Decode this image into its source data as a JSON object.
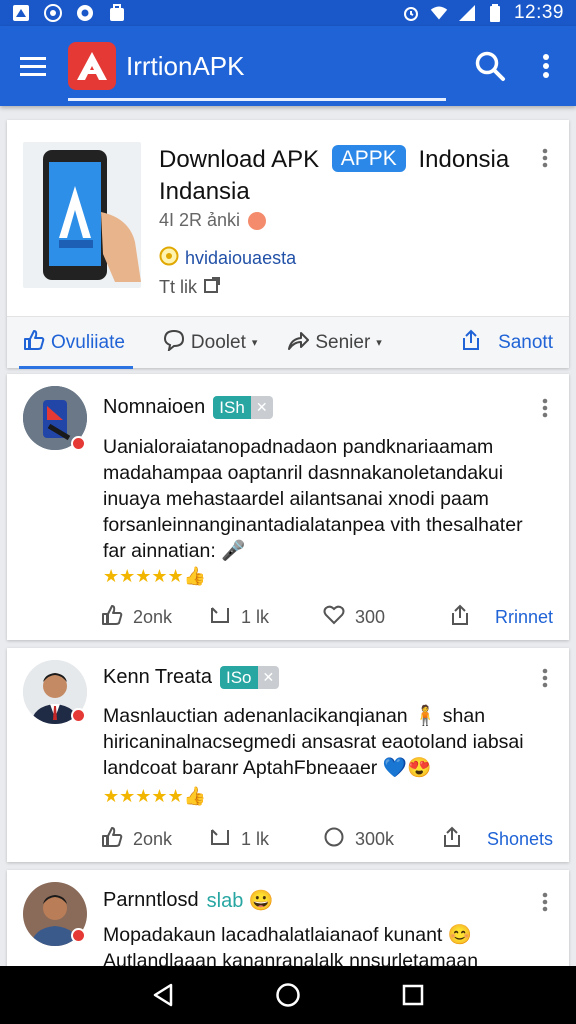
{
  "status_bar": {
    "time": "12:39",
    "icons": [
      "notification-icon",
      "whatsapp-icon",
      "circle-app-icon",
      "bag-icon",
      "alarm-icon",
      "wifi-icon",
      "signal-icon",
      "battery-icon"
    ]
  },
  "app_bar": {
    "title": "IrrtionAPK",
    "icons": [
      "menu-icon",
      "app-logo-icon",
      "search-icon",
      "more-vert-icon"
    ]
  },
  "app_card": {
    "title_before": "Download APK",
    "badge": "APPK",
    "title_after": "Indonsia Indansia",
    "meta": "4I 2R ảnki",
    "developer": "hvidaiouaesta",
    "link": "Tt lik",
    "actions": [
      {
        "label": "Ovuliiate",
        "icon": "thumbs-up-icon"
      },
      {
        "label": "Doolet",
        "icon": "comment-icon"
      },
      {
        "label": "Senier",
        "icon": "share-arrow-icon"
      },
      {
        "label": "Sanott",
        "icon": "share-box-icon"
      }
    ]
  },
  "posts": [
    {
      "name": "Nomnaioen",
      "tag": "ISh",
      "text_lines": [
        "Uanialoraiatanopadnadaon pandknariaamam",
        "madahampaa oaptanril dasnnakanoletandakui",
        "inuaya mehastaardel ailantsanai xnodi paam",
        "forsanleinnanginantadialatanpea vith thesalhater",
        "far ainnatian: 🎤"
      ],
      "stars": "★★★★★👍",
      "likes": "2onk",
      "replies": "1 lk",
      "comments": "300",
      "share": "Rrinnet"
    },
    {
      "name": "Kenn Treata",
      "tag": "ISo",
      "text_lines": [
        "Masnlauctian adenanlacikanqianan 🧍 shan",
        "hiricaninalnacsegmedi ansasrat eaotoland iabsai",
        "landcoat baranr AptahFbneaaer 💙😍"
      ],
      "stars": "★★★★★👍",
      "likes": "2onk",
      "replies": "1 lk",
      "comments": "300k",
      "share": "Shonets"
    },
    {
      "name": "Parnntlosd",
      "tag_plain": "slab 😀",
      "text_lines": [
        "Mopadakaun lacadhalatlaianaof kunant 😊",
        "Autlandlaaan kananranalalk nnsurletamaan"
      ]
    }
  ],
  "nav": {
    "icons": [
      "back-icon",
      "home-icon",
      "recents-icon"
    ]
  },
  "colors": {
    "app_bar": "#1f63d6",
    "status_bar": "#1a58c9",
    "accent": "#2b88e8",
    "tag": "#27a6a2",
    "star": "#f2b600"
  }
}
